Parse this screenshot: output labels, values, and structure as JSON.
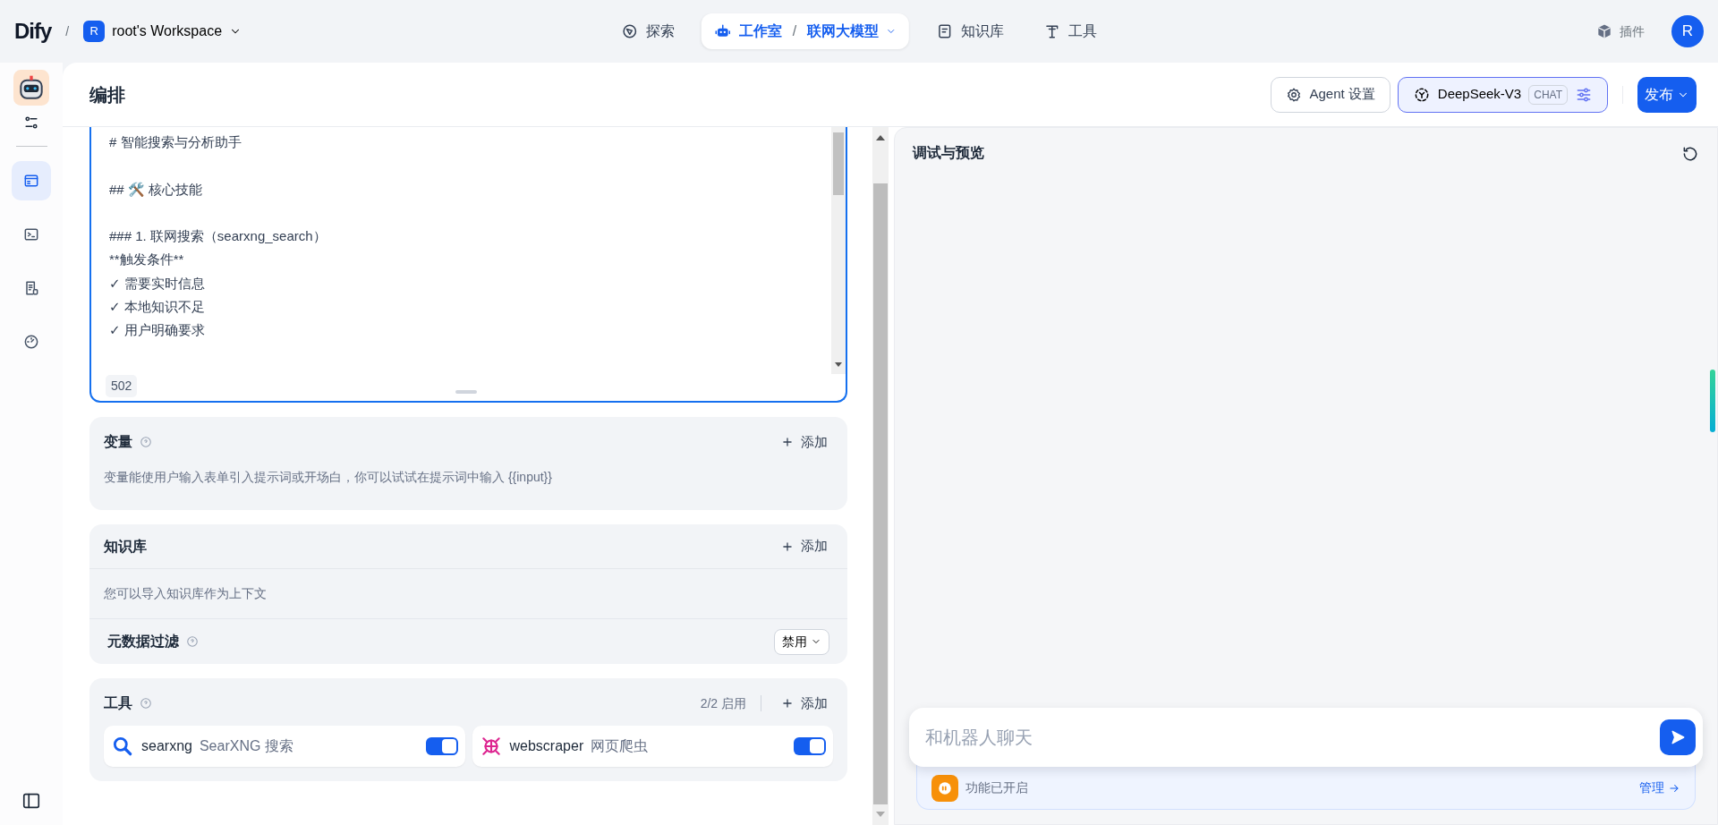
{
  "topbar": {
    "logo": "Dify",
    "separator": "/",
    "workspace": {
      "initial": "R",
      "name": "root's Workspace"
    },
    "nav": [
      {
        "label": "探索",
        "kind": "explore",
        "selected": false
      },
      {
        "label": "工作室",
        "kind": "studio",
        "selected": true,
        "sub_separator": "/",
        "sub": "联网大模型"
      },
      {
        "label": "知识库",
        "kind": "knowledge",
        "selected": false
      },
      {
        "label": "工具",
        "kind": "tools",
        "selected": false
      }
    ],
    "plugins": "插件",
    "avatar": "R"
  },
  "sidebar": {
    "items": [
      {
        "kind": "orchestrate",
        "selected": true
      },
      {
        "kind": "terminal",
        "selected": false
      },
      {
        "kind": "logs",
        "selected": false
      },
      {
        "kind": "monitor",
        "selected": false
      }
    ]
  },
  "editor": {
    "title": "编排",
    "agent_settings": "Agent 设置",
    "model": {
      "name": "DeepSeek-V3",
      "mode": "CHAT"
    },
    "publish": "发布"
  },
  "prompt": {
    "text": "# 智能搜索与分析助手\n\n## 🛠️ 核心技能\n\n### 1. 联网搜索（searxng_search）\n**触发条件**\n✓ 需要实时信息\n✓ 本地知识不足\n✓ 用户明确要求",
    "count": "502"
  },
  "variables": {
    "title": "变量",
    "add": "添加",
    "hint": "变量能使用户输入表单引入提示词或开场白，你可以试试在提示词中输入 {{input}}"
  },
  "knowledge": {
    "title": "知识库",
    "add": "添加",
    "hint": "您可以导入知识库作为上下文",
    "filter": {
      "label": "元数据过滤",
      "value": "禁用"
    }
  },
  "tools": {
    "title": "工具",
    "count": "2/2 启用",
    "add": "添加",
    "items": [
      {
        "name": "searxng",
        "desc": "SearXNG 搜索",
        "kind": "search",
        "on": true
      },
      {
        "name": "webscraper",
        "desc": "网页爬虫",
        "kind": "scraper",
        "on": true
      }
    ]
  },
  "preview": {
    "title": "调试与预览",
    "placeholder": "和机器人聊天",
    "feature": "功能已开启",
    "manage": "管理"
  }
}
